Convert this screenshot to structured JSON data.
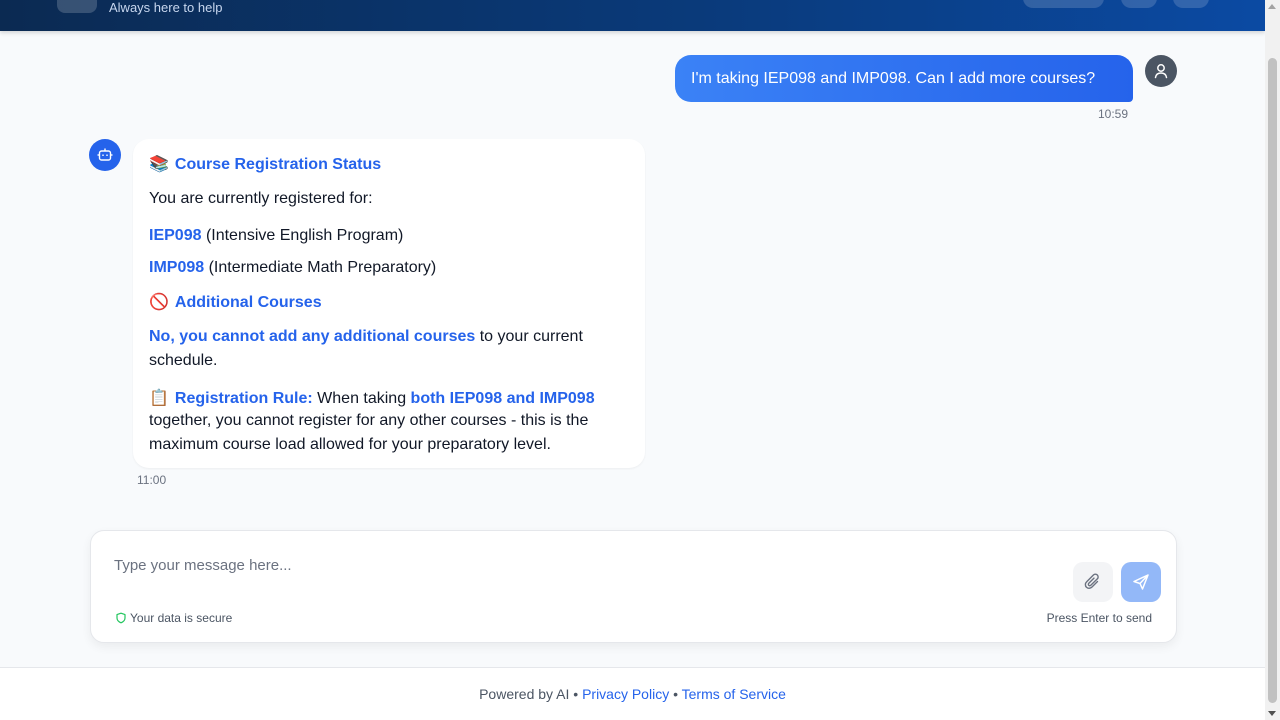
{
  "header": {
    "subtitle": "Always here to help"
  },
  "conversation": {
    "user_message": {
      "text": "I'm taking IEP098 and IMP098. Can I add more courses?",
      "time": "10:59"
    },
    "bot_message": {
      "heading_emoji": "📚",
      "heading": "Course Registration Status",
      "intro": "You are currently registered for:",
      "courses": [
        {
          "code": "IEP098",
          "name": "(Intensive English Program)"
        },
        {
          "code": "IMP098",
          "name": "(Intermediate Math Preparatory)"
        }
      ],
      "section_emoji": "🚫",
      "section_heading": "Additional Courses",
      "answer_bold": "No, you cannot add any additional courses",
      "answer_rest_1": " to your current",
      "answer_rest_2": "schedule.",
      "rule_emoji": "📋",
      "rule_label": "Registration Rule:",
      "rule_text_1": " When taking ",
      "rule_bold": "both IEP098 and IMP098",
      "rule_text_2": "together, you cannot register for any other courses - this is the",
      "rule_text_3": "maximum course load allowed for your preparatory level.",
      "time": "11:00"
    }
  },
  "composer": {
    "placeholder": "Type your message here...",
    "value": "",
    "secure_text": "Your data is secure",
    "hint": "Press Enter to send",
    "attach_icon": "paperclip-icon",
    "send_icon": "send-icon"
  },
  "footer": {
    "powered": "Powered by AI",
    "sep": "•",
    "privacy": "Privacy Policy",
    "terms": "Terms of Service"
  },
  "colors": {
    "accent": "#2563eb",
    "header_dark": "#0b2a52",
    "secure_green": "#22c55e"
  }
}
